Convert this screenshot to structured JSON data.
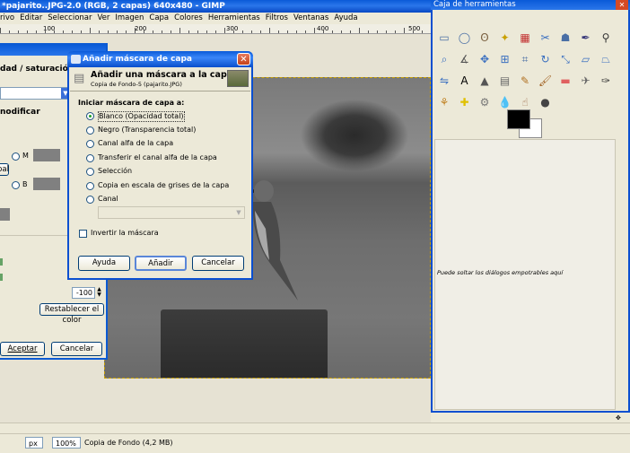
{
  "main_window": {
    "title": "*pajarito..JPG-2.0 (RGB, 2 capas) 640x480 - GIMP",
    "menu": [
      "rivo",
      "Editar",
      "Seleccionar",
      "Ver",
      "Imagen",
      "Capa",
      "Colores",
      "Herramientas",
      "Filtros",
      "Ventanas",
      "Ayuda"
    ],
    "ruler_labels": [
      "100",
      "200",
      "300",
      "400",
      "500"
    ],
    "status": {
      "unit": "px",
      "zoom": "100%",
      "layer_info": "Copia de Fondo (4,2 MB)"
    }
  },
  "hue_dialog": {
    "title_fragment": "dad / saturació",
    "section_label": "nodificar",
    "radio_m": "M",
    "radio_b": "B",
    "button_fragment": "pal",
    "spin_value": "-100",
    "reset_label": "Restablecer el color",
    "accept_label": "Aceptar",
    "cancel_label": "Cancelar"
  },
  "mask_dialog": {
    "title": "Añadir máscara de capa",
    "heading": "Añadir una máscara a la capa",
    "subheading": "Copia de Fondo-5 (pajarito.JPG)",
    "section_label": "Iniciar máscara de capa a:",
    "options": [
      {
        "label": "Blanco (Opacidad total)",
        "selected": true
      },
      {
        "label": "Negro (Transparencia total)",
        "selected": false
      },
      {
        "label": "Canal alfa de la capa",
        "selected": false
      },
      {
        "label": "Transferir el canal alfa de la capa",
        "selected": false
      },
      {
        "label": "Selección",
        "selected": false
      },
      {
        "label": "Copia en escala de grises de la capa",
        "selected": false
      },
      {
        "label": "Canal",
        "selected": false
      }
    ],
    "invert_label": "Invertir la máscara",
    "help_label": "Ayuda",
    "add_label": "Añadir",
    "cancel_label": "Cancelar"
  },
  "toolbox": {
    "title": "Caja de herramientas",
    "dock_hint": "Puede soltar los diálogos empotrables aquí",
    "fg_color": "#000000",
    "bg_color": "#ffffff",
    "tools": [
      "rect-select-icon",
      "ellipse-select-icon",
      "free-select-icon",
      "fuzzy-select-icon",
      "color-select-icon",
      "scissors-icon",
      "foreground-select-icon",
      "paths-icon",
      "color-picker-icon",
      "zoom-icon",
      "measure-icon",
      "move-icon",
      "align-icon",
      "crop-icon",
      "rotate-icon",
      "scale-icon",
      "shear-icon",
      "perspective-icon",
      "flip-icon",
      "text-icon",
      "bucket-fill-icon",
      "blend-icon",
      "pencil-icon",
      "paintbrush-icon",
      "eraser-icon",
      "airbrush-icon",
      "ink-icon",
      "clone-icon",
      "heal-icon",
      "perspective-clone-icon",
      "blur-icon",
      "smudge-icon",
      "dodge-burn-icon"
    ]
  }
}
